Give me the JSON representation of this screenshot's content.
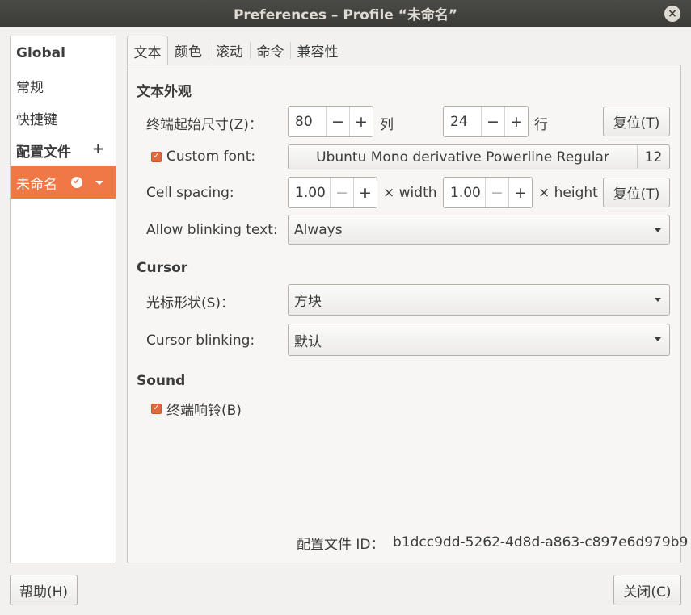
{
  "window": {
    "title": "Preferences – Profile “未命名”",
    "close_glyph": "×"
  },
  "sidebar": {
    "global": "Global",
    "general": "常规",
    "shortcuts": "快捷键",
    "profiles": "配置文件",
    "add_glyph": "+",
    "profile_name": "未命名",
    "check_glyph": "✔"
  },
  "tabs": [
    "文本",
    "颜色",
    "滚动",
    "命令",
    "兼容性"
  ],
  "text_tab": {
    "appearance_title": "文本外观",
    "size_label": "终端起始尺寸(Z)：",
    "columns_value": "80",
    "columns_unit": "列",
    "rows_value": "24",
    "rows_unit": "行",
    "reset_label": "复位(T)",
    "minus_glyph": "−",
    "plus_glyph": "+",
    "custom_font_label": "Custom font:",
    "custom_font_checked": true,
    "font_name": "Ubuntu Mono derivative Powerline Regular",
    "font_size": "12",
    "cell_spacing_label": "Cell spacing:",
    "width_value": "1.00",
    "width_unit": "× width",
    "height_value": "1.00",
    "height_unit": "× height",
    "blink_text_label": "Allow blinking text:",
    "blink_text_value": "Always",
    "cursor_title": "Cursor",
    "cursor_shape_label": "光标形状(S)：",
    "cursor_shape_value": "方块",
    "cursor_blink_label": "Cursor blinking:",
    "cursor_blink_value": "默认",
    "sound_title": "Sound",
    "bell_label": "终端响铃(B)",
    "bell_checked": true,
    "profile_id_label": "配置文件 ID：",
    "profile_id_value": "b1dcc9dd-5262-4d8d-a863-c897e6d979b9"
  },
  "footer": {
    "help_label": "帮助(H)",
    "close_label": "关闭(C)"
  },
  "colors": {
    "accent": "#f07746",
    "titlebar": "#3b3b38",
    "window_bg": "#f2f1f0"
  }
}
